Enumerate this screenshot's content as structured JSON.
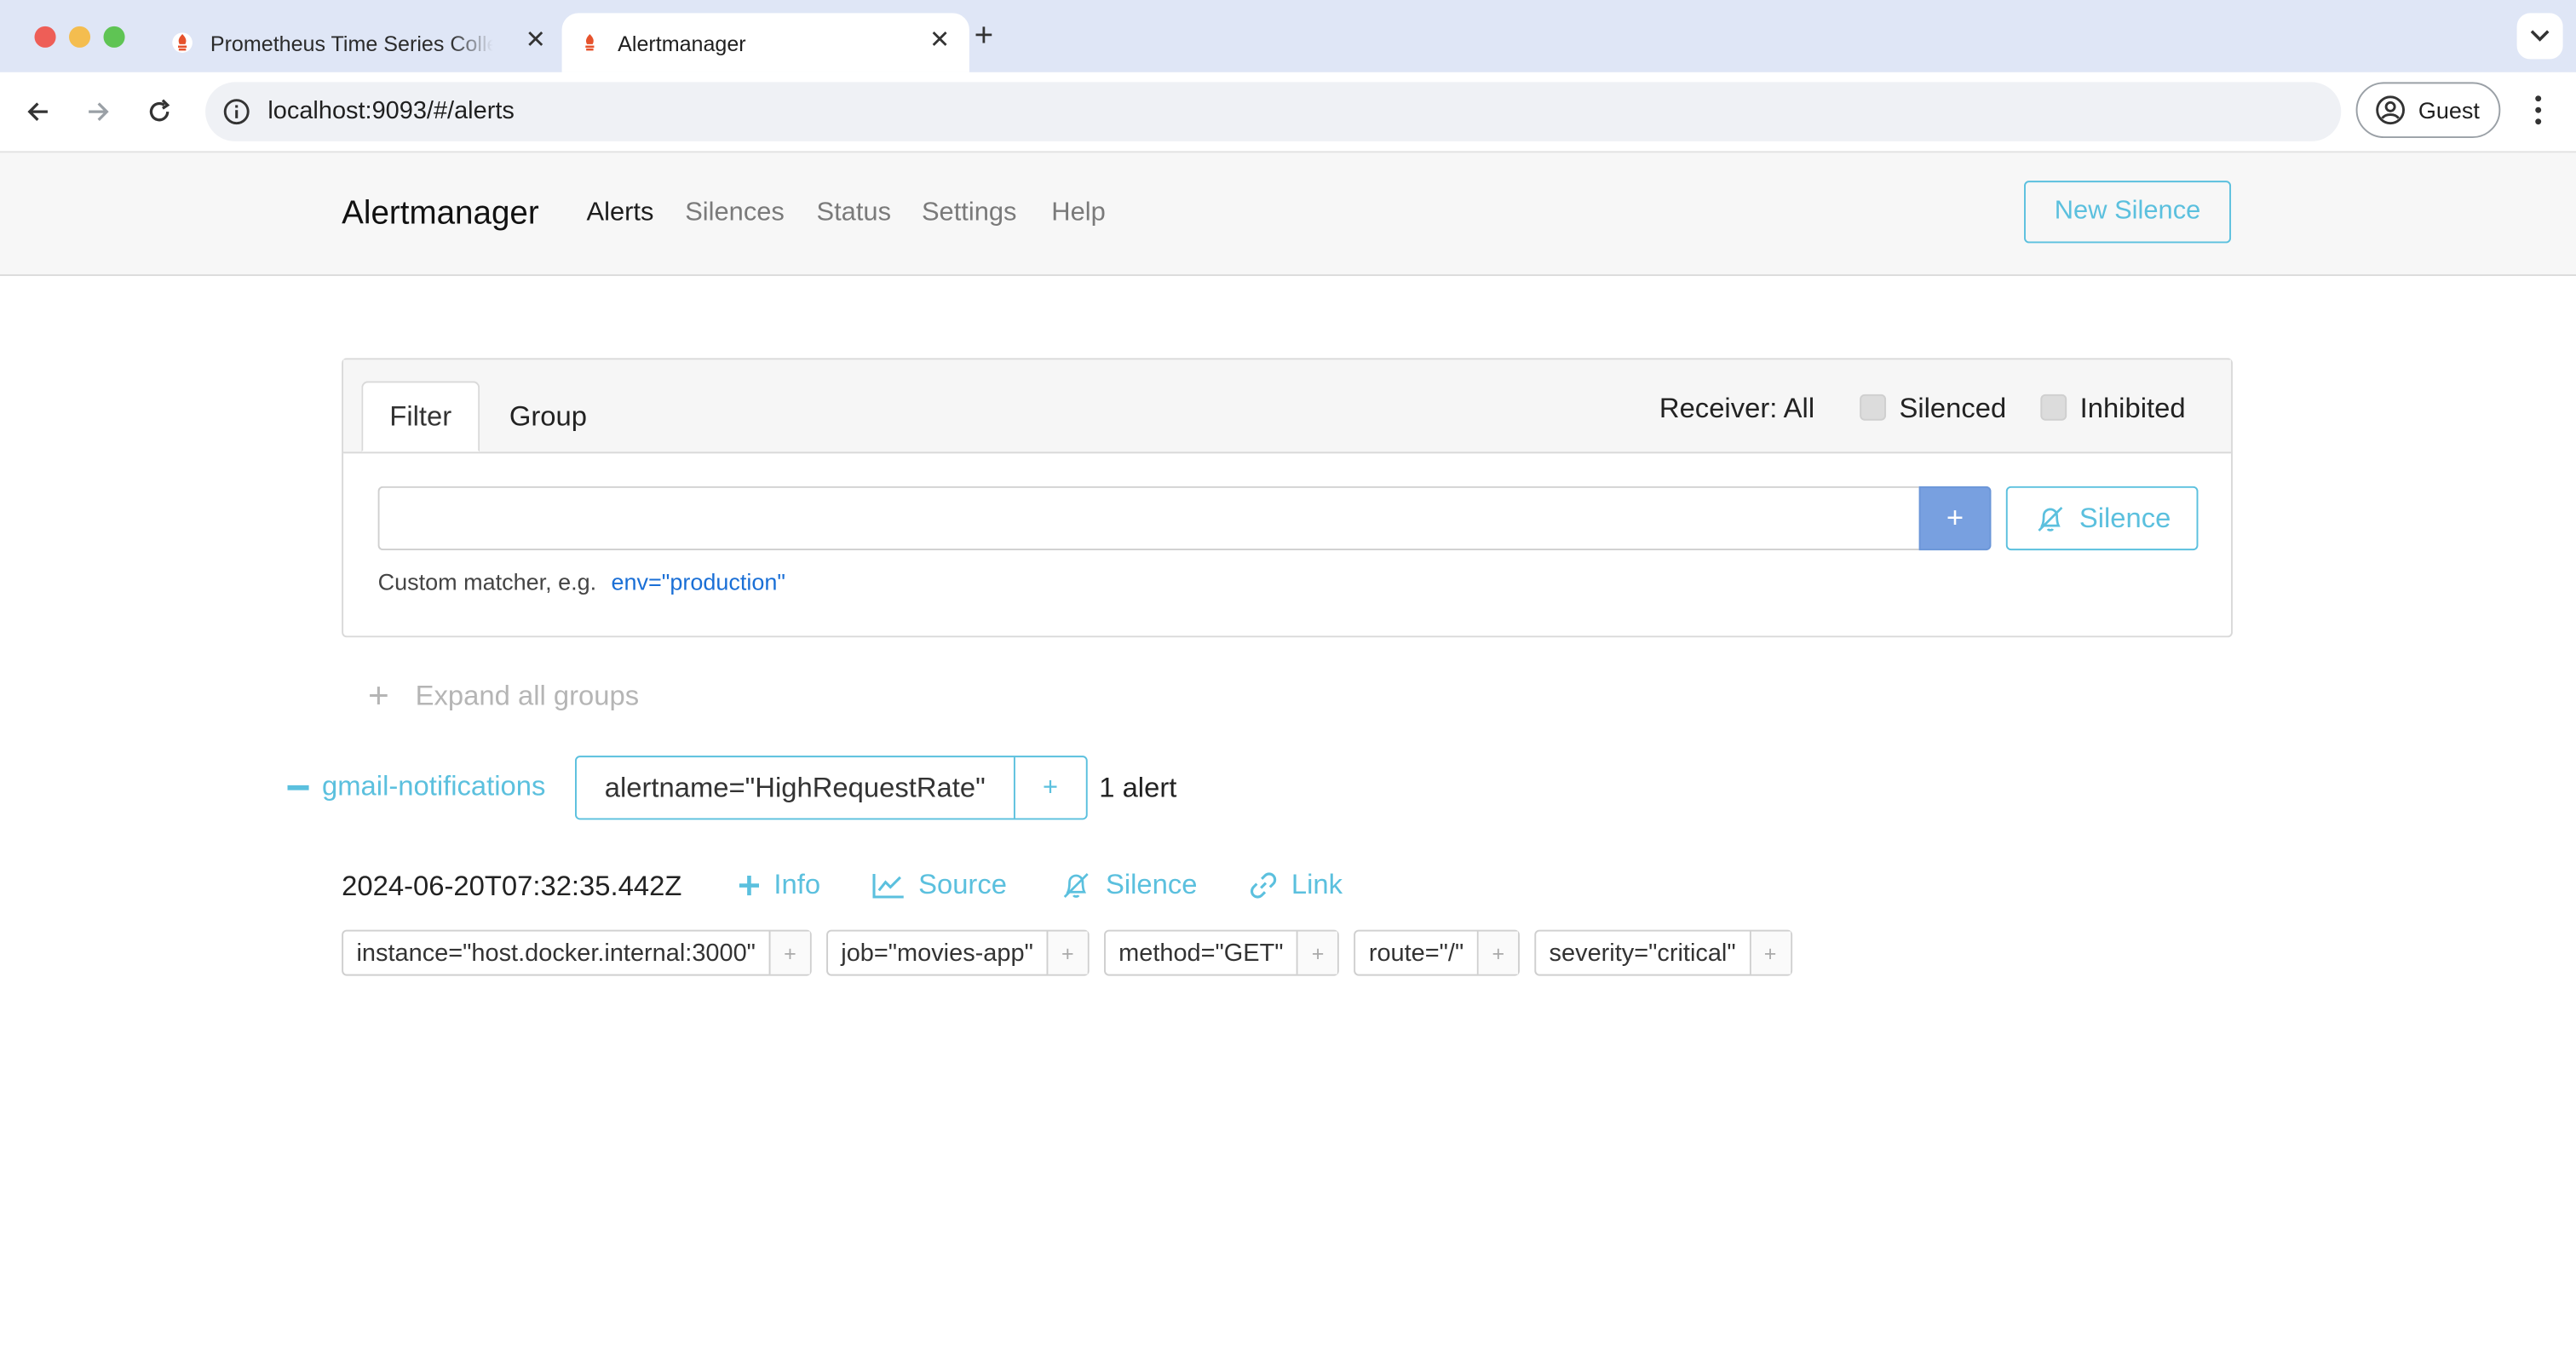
{
  "browser": {
    "tabs": [
      {
        "title": "Prometheus Time Series Collection and Processing Server",
        "active": false
      },
      {
        "title": "Alertmanager",
        "active": true
      }
    ],
    "address": "localhost:9093/#/alerts",
    "profile_label": "Guest"
  },
  "navbar": {
    "brand": "Alertmanager",
    "links": [
      "Alerts",
      "Silences",
      "Status",
      "Settings",
      "Help"
    ],
    "active": "Alerts",
    "new_silence_label": "New Silence"
  },
  "filter_card": {
    "tabs": [
      "Filter",
      "Group"
    ],
    "active_tab": "Filter",
    "receiver_label": "Receiver: All",
    "silenced_label": "Silenced",
    "silenced_checked": false,
    "inhibited_label": "Inhibited",
    "inhibited_checked": false,
    "matcher_value": "",
    "add_button": "+",
    "silence_button": "Silence",
    "hint_text": "Custom matcher, e.g.",
    "hint_example": "env=\"production\""
  },
  "groups": {
    "expand_all_label": "Expand all groups",
    "items": [
      {
        "receiver": "gmail-notifications",
        "matcher": "alertname=\"HighRequestRate\"",
        "count_label": "1 alert",
        "alerts": [
          {
            "starts_at": "2024-06-20T07:32:35.442Z",
            "actions": [
              "Info",
              "Source",
              "Silence",
              "Link"
            ],
            "labels": [
              "instance=\"host.docker.internal:3000\"",
              "job=\"movies-app\"",
              "method=\"GET\"",
              "route=\"/\"",
              "severity=\"critical\""
            ]
          }
        ]
      }
    ]
  },
  "colors": {
    "accent": "#5bc0de",
    "primary_button": "#78a0e0",
    "link": "#1a6fd6"
  }
}
